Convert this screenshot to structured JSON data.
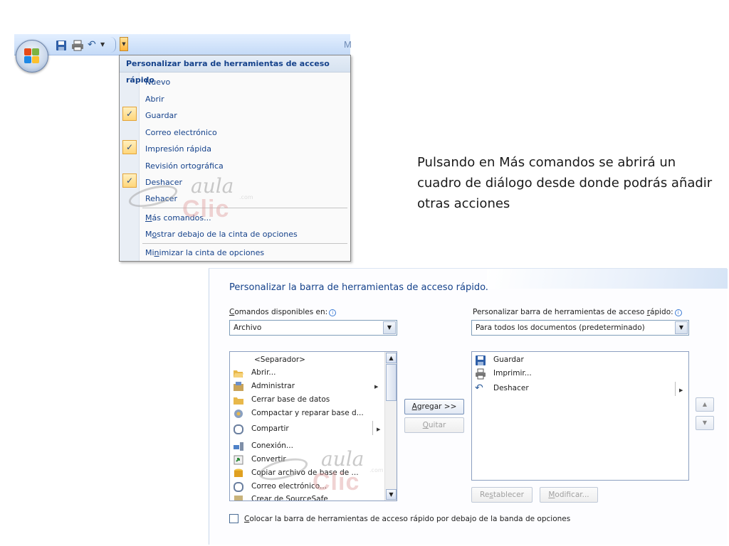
{
  "toolbar": {
    "title_fragment": "M",
    "save_tooltip": "Guardar",
    "print_tooltip": "Impresión rápida",
    "undo_tooltip": "Deshacer"
  },
  "menu": {
    "title": "Personalizar barra de herramientas de acceso rápido",
    "items": [
      {
        "label": "Nuevo",
        "checked": false
      },
      {
        "label": "Abrir",
        "checked": false
      },
      {
        "label": "Guardar",
        "checked": true
      },
      {
        "label": "Correo electrónico",
        "checked": false
      },
      {
        "label": "Impresión rápida",
        "checked": true
      },
      {
        "label": "Revisión ortográfica",
        "checked": false
      },
      {
        "label": "Deshacer",
        "checked": true
      },
      {
        "label": "Rehacer",
        "checked": false
      }
    ],
    "mas_comandos": {
      "pre": "",
      "key": "M",
      "post": "ás comandos..."
    },
    "mostrar_debajo": {
      "pre": "M",
      "key": "o",
      "post": "strar debajo de la cinta de opciones"
    },
    "minimizar": {
      "pre": "Mi",
      "key": "n",
      "post": "imizar la cinta de opciones"
    }
  },
  "caption": "Pulsando en Más comandos se abrirá un cuadro de diálogo desde donde podrás añadir otras acciones",
  "dialog": {
    "title": "Personalizar la barra de herramientas de acceso rápido.",
    "commands_label": {
      "pre": "",
      "key": "C",
      "post": "omandos disponibles en:"
    },
    "commands_value": "Archivo",
    "customize_label": {
      "pre": "Personalizar barra de herramientas de acceso ",
      "key": "r",
      "post": "ápido:"
    },
    "customize_value": "Para todos los documentos (predeterminado)",
    "available_commands": [
      {
        "label": "<Separador>",
        "icon": "separator",
        "submenu": false
      },
      {
        "label": "Abrir...",
        "icon": "folder-open-icon",
        "submenu": false
      },
      {
        "label": "Administrar",
        "icon": "manage-icon",
        "submenu": true
      },
      {
        "label": "Cerrar base de datos",
        "icon": "folder-close-icon",
        "submenu": false
      },
      {
        "label": "Compactar y reparar base d...",
        "icon": "compact-icon",
        "submenu": false
      },
      {
        "label": "Compartir",
        "icon": "share-icon",
        "submenu": true
      },
      {
        "label": "Conexión...",
        "icon": "connection-icon",
        "submenu": false
      },
      {
        "label": "Convertir",
        "icon": "convert-icon",
        "submenu": false
      },
      {
        "label": "Copiar archivo de base de ...",
        "icon": "copy-db-icon",
        "submenu": false
      },
      {
        "label": "Correo electrónico...",
        "icon": "email-icon",
        "submenu": false
      },
      {
        "label": "Crear de SourceSafe",
        "icon": "sourcesafe-icon",
        "submenu": false
      }
    ],
    "toolbar_commands": [
      {
        "label": "Guardar",
        "icon": "save-icon"
      },
      {
        "label": "Imprimir...",
        "icon": "print-icon"
      },
      {
        "label": "Deshacer",
        "icon": "undo-icon"
      }
    ],
    "add_button": {
      "pre": "",
      "key": "A",
      "post": "gregar >>"
    },
    "remove_button": {
      "pre": "",
      "key": "Q",
      "post": "uitar"
    },
    "reset_button": {
      "pre": "Re",
      "key": "s",
      "post": "tablecer"
    },
    "modify_button": {
      "pre": "",
      "key": "M",
      "post": "odificar..."
    },
    "checkbox_label": {
      "pre": "",
      "key": "C",
      "post": "olocar la barra de herramientas de acceso rápido por debajo de la banda de opciones"
    },
    "checkbox_checked": false
  },
  "colors": {
    "accent_text": "#15428b",
    "check_highlight": "#ffd67a",
    "menu_gutter": "#e9eef5"
  }
}
